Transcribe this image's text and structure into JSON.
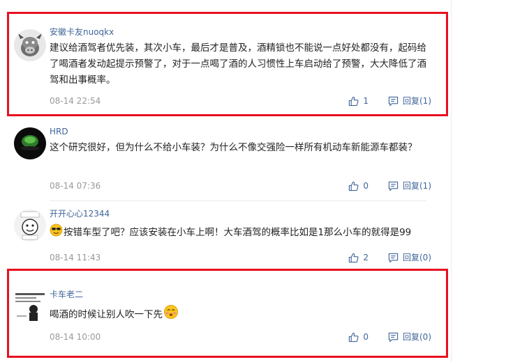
{
  "comments": [
    {
      "username": "安徽卡友nuoqkx",
      "content": "建议给酒驾者优先装，其次小车，最后才是普及，酒精锁也不能说一点好处都没有，起码给了喝酒者发动起提示预警了，对于一点喝了酒的人习惯性上车启动给了预警，大大降低了酒驾和出事概率。",
      "time": "08-14 22:54",
      "likes": "1",
      "reply_label": "回复(1)",
      "highlighted": true
    },
    {
      "username": "HRD",
      "content": "这个研究很好，但为什么不给小车装？为什么不像交强险一样所有机动车新能源车都装？",
      "time": "08-14 07:36",
      "likes": "0",
      "reply_label": "回复(1)",
      "highlighted": false
    },
    {
      "username": "开开心心12344",
      "content": "按错车型了吧？应该安装在小车上啊！大车酒驾的概率比如是1那么小车的就得是99",
      "time": "08-14 11:43",
      "likes": "2",
      "reply_label": "回复(0)",
      "highlighted": false
    },
    {
      "username": "卡车老二",
      "content": "喝酒的时候让别人吹一下先",
      "time": "08-14 10:00",
      "likes": "0",
      "reply_label": "回复(0)",
      "highlighted": true
    }
  ],
  "colors": {
    "highlight_border": "#e8101f",
    "username": "#406599",
    "meta": "#999999"
  }
}
